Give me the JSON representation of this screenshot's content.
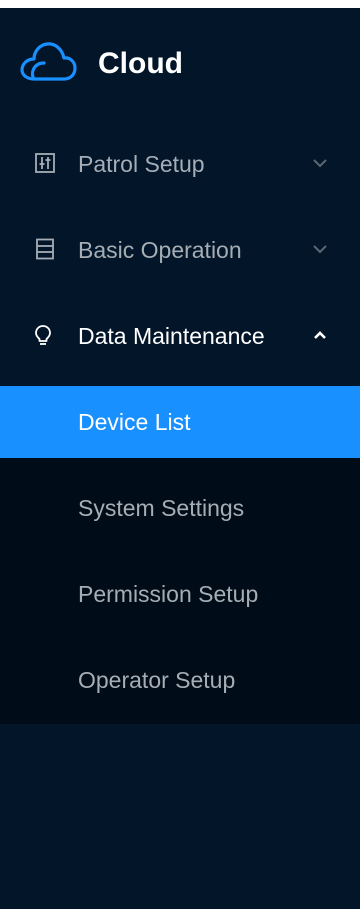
{
  "brand": {
    "title": "Cloud",
    "logo_icon": "cloud-icon",
    "logo_color": "#1890ff"
  },
  "colors": {
    "sidebar_bg": "#021529",
    "submenu_bg": "#000c17",
    "active_bg": "#1890ff",
    "text_muted": "#a6adb4",
    "text_active": "#ffffff"
  },
  "menu": {
    "items": [
      {
        "label": "Patrol Setup",
        "icon": "sliders-icon",
        "expanded": false
      },
      {
        "label": "Basic Operation",
        "icon": "server-icon",
        "expanded": false
      },
      {
        "label": "Data Maintenance",
        "icon": "bulb-icon",
        "expanded": true
      }
    ],
    "submenu": [
      {
        "label": "Device List",
        "active": true
      },
      {
        "label": "System Settings",
        "active": false
      },
      {
        "label": "Permission Setup",
        "active": false
      },
      {
        "label": "Operator Setup",
        "active": false
      }
    ]
  }
}
